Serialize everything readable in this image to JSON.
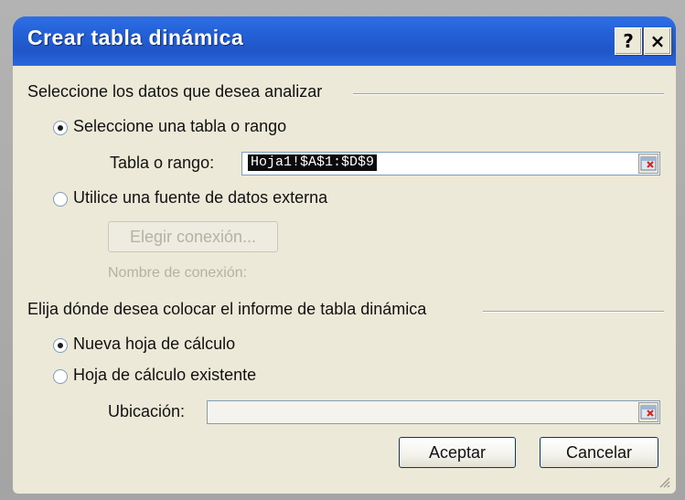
{
  "window": {
    "title": "Crear tabla dinámica",
    "help_button": "?",
    "close_button": "×"
  },
  "section_data": {
    "heading": "Seleccione los datos que desea analizar",
    "option_table": "Seleccione una tabla o rango",
    "option_table_selected": true,
    "range_label": "Tabla o rango:",
    "range_value": "Hoja1!$A$1:$D$9",
    "option_external": "Utilice una fuente de datos externa",
    "option_external_selected": false,
    "choose_connection_button": "Elegir conexión...",
    "connection_name_label": "Nombre de conexión:"
  },
  "section_location": {
    "heading": "Elija dónde desea colocar el informe de tabla dinámica",
    "option_new_sheet": "Nueva hoja de cálculo",
    "option_new_sheet_selected": true,
    "option_existing_sheet": "Hoja de cálculo existente",
    "option_existing_sheet_selected": false,
    "location_label": "Ubicación:",
    "location_value": ""
  },
  "buttons": {
    "ok": "Aceptar",
    "cancel": "Cancelar"
  },
  "icons": {
    "range_picker": "range-picker-icon",
    "location_picker": "range-picker-icon",
    "resize_grip": "resize-grip-icon"
  },
  "colors": {
    "titlebar": "#2462d8",
    "dialog_background": "#ece9d8",
    "selection_background": "#0b0b0b",
    "field_border": "#7f9db9"
  }
}
